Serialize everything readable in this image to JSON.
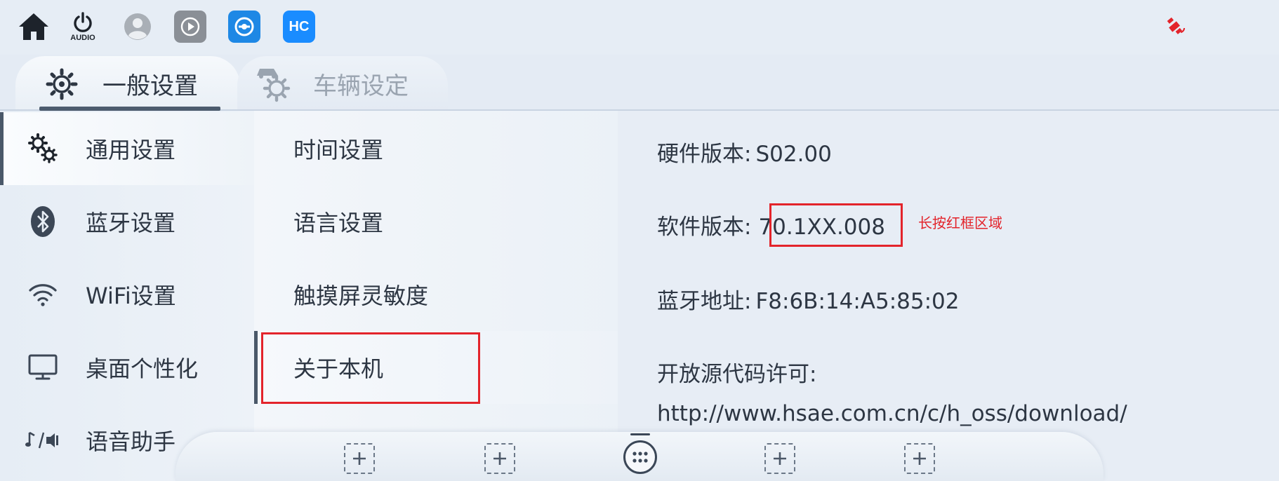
{
  "statusbar": {
    "audio_label": "AUDIO",
    "icons": [
      "home-icon",
      "power-icon",
      "user-avatar-icon",
      "carplay-app-icon",
      "car-app-icon",
      "hicar-app-icon",
      "satellite-icon"
    ],
    "hicar_text": "HC"
  },
  "tabs": [
    {
      "label": "一般设置",
      "active": true
    },
    {
      "label": "车辆设定",
      "active": false
    }
  ],
  "sidebar": {
    "items": [
      {
        "label": "通用设置",
        "icon": "gears-icon",
        "active": true
      },
      {
        "label": "蓝牙设置",
        "icon": "bluetooth-icon",
        "active": false
      },
      {
        "label": "WiFi设置",
        "icon": "wifi-icon",
        "active": false
      },
      {
        "label": "桌面个性化",
        "icon": "monitor-icon",
        "active": false
      },
      {
        "label": "语音助手",
        "icon": "voice-icon",
        "active": false
      }
    ]
  },
  "submenu": {
    "items": [
      {
        "label": "时间设置",
        "selected": false
      },
      {
        "label": "语言设置",
        "selected": false
      },
      {
        "label": "触摸屏灵敏度",
        "selected": false
      },
      {
        "label": "关于本机",
        "selected": true
      }
    ]
  },
  "detail": {
    "hardware_label": "硬件版本:",
    "hardware_value": "S02.00",
    "software_label": "软件版本:",
    "software_value": "70.1XX.008",
    "hint": "长按红框区域",
    "bt_label": "蓝牙地址:",
    "bt_value": "F8:6B:14:A5:85:02",
    "oss_label": "开放源代码许可:",
    "oss_url": "http://www.hsae.com.cn/c/h_oss/download/"
  },
  "colors": {
    "accent_red": "#e3242b",
    "hicar_blue": "#1a8cff",
    "car_app_blue": "#1e88e5",
    "carplay_gray": "#8a8f96",
    "satellite_red": "#e3242b"
  }
}
